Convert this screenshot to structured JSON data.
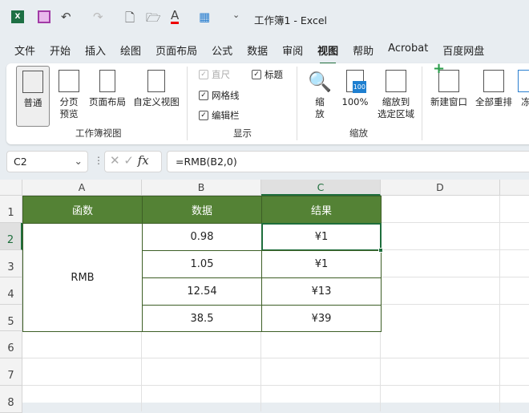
{
  "title_bar": {
    "title": "工作簿1  -  Excel"
  },
  "menu_tabs": [
    "文件",
    "开始",
    "插入",
    "绘图",
    "页面布局",
    "公式",
    "数据",
    "审阅",
    "视图",
    "帮助",
    "Acrobat",
    "百度网盘"
  ],
  "active_tab": "视图",
  "ribbon": {
    "workbook_views": {
      "label": "工作簿视图",
      "buttons": [
        "普通",
        "分页\n预览",
        "页面布局",
        "自定义视图"
      ]
    },
    "show": {
      "label": "显示",
      "ruler": "直尺",
      "gridlines": "网格线",
      "formula_bar": "编辑栏",
      "headings": "标题"
    },
    "zoom": {
      "label": "缩放",
      "zoom": "缩\n放",
      "zoom100": "100%",
      "zoom_selection": "缩放到\n选定区域",
      "badge": "100"
    },
    "window": {
      "new_window": "新建窗口",
      "arrange_all": "全部重排",
      "freeze": "冻"
    }
  },
  "formula_bar": {
    "name_box": "C2",
    "fx": "fx",
    "formula": "=RMB(B2,0)"
  },
  "columns": [
    "A",
    "B",
    "C",
    "D"
  ],
  "rows": [
    "1",
    "2",
    "3",
    "4",
    "5",
    "6",
    "7",
    "8"
  ],
  "table": {
    "headers": [
      "函数",
      "数据",
      "结果"
    ],
    "function_name": "RMB",
    "data": [
      "0.98",
      "1.05",
      "12.54",
      "38.5"
    ],
    "results": [
      "¥1",
      "¥1",
      "¥13",
      "¥39"
    ]
  },
  "colors": {
    "header_fill": "#548235",
    "accent": "#1e6e3c"
  }
}
